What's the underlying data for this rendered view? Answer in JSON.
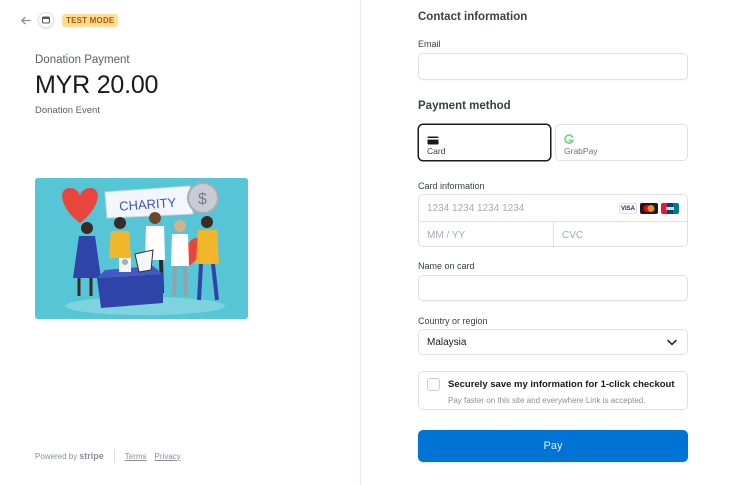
{
  "header": {
    "back_icon": "arrow-left-icon",
    "merchant_logo_icon": "store-logo-icon",
    "test_mode_badge": "TEST MODE"
  },
  "summary": {
    "product_name": "Donation Payment",
    "amount": "MYR 20.00",
    "event_label": "Donation Event",
    "image_banner_text": "CHARITY",
    "image_coin_symbol": "$"
  },
  "footer": {
    "powered_by": "Powered by",
    "brand": "stripe",
    "terms": "Terms",
    "privacy": "Privacy"
  },
  "contact": {
    "title": "Contact information",
    "email_label": "Email",
    "email_value": "",
    "email_placeholder": ""
  },
  "payment_method": {
    "title": "Payment method",
    "options": [
      {
        "label": "Card",
        "icon": "credit-card-icon",
        "selected": true
      },
      {
        "label": "GrabPay",
        "icon": "grabpay-icon",
        "selected": false
      }
    ]
  },
  "card": {
    "label": "Card information",
    "number_placeholder": "1234 1234 1234 1234",
    "expiry_placeholder": "MM / YY",
    "cvc_placeholder": "CVC",
    "brands": [
      {
        "name": "VISA",
        "icon": "visa-icon"
      },
      {
        "name": "Mastercard",
        "icon": "mastercard-icon"
      },
      {
        "name": "UnionPay",
        "icon": "unionpay-icon"
      }
    ]
  },
  "name_on_card": {
    "label": "Name on card",
    "value": ""
  },
  "country": {
    "label": "Country or region",
    "selected": "Malaysia"
  },
  "save_info": {
    "title": "Securely save my information for 1-click checkout",
    "subtitle": "Pay faster on this site and everywhere Link is accepted.",
    "checked": false
  },
  "pay_button": {
    "label": "Pay"
  },
  "colors": {
    "accent": "#0074d4",
    "badge_bg": "#ffde92",
    "badge_text": "#bb5504",
    "image_bg": "#56c5d6"
  }
}
